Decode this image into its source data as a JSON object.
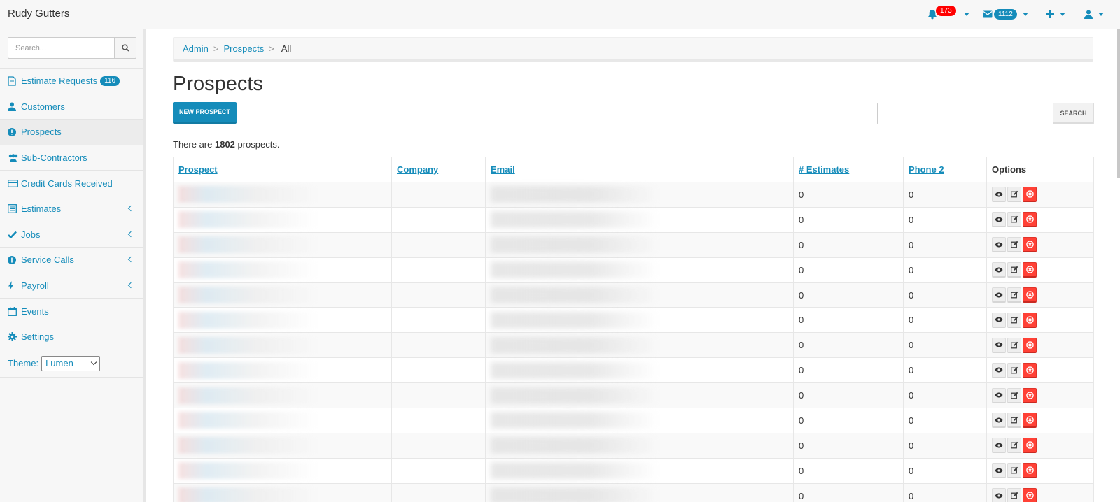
{
  "app": {
    "brand": "Rudy Gutters"
  },
  "topnav": {
    "notifications_count": "173",
    "messages_count": "1112"
  },
  "sidebar": {
    "search_placeholder": "Search...",
    "items": [
      {
        "label": "Estimate Requests",
        "badge": "116",
        "icon": "file-text-icon"
      },
      {
        "label": "Customers",
        "icon": "user-icon"
      },
      {
        "label": "Prospects",
        "icon": "exclamation-circle-icon",
        "active": true
      },
      {
        "label": "Sub-Contractors",
        "icon": "users-icon"
      },
      {
        "label": "Credit Cards Received",
        "icon": "credit-card-icon"
      },
      {
        "label": "Estimates",
        "icon": "list-alt-icon",
        "expandable": true
      },
      {
        "label": "Jobs",
        "icon": "check-icon",
        "expandable": true
      },
      {
        "label": "Service Calls",
        "icon": "exclamation-circle-icon",
        "expandable": true
      },
      {
        "label": "Payroll",
        "icon": "bolt-icon",
        "expandable": true
      },
      {
        "label": "Events",
        "icon": "calendar-icon"
      },
      {
        "label": "Settings",
        "icon": "gear-icon"
      }
    ],
    "theme_label": "Theme:",
    "theme_value": "Lumen"
  },
  "breadcrumb": {
    "admin": "Admin",
    "prospects": "Prospects",
    "current": "All",
    "sep": ">"
  },
  "page": {
    "title": "Prospects",
    "new_button": "NEW PROSPECT",
    "search_button": "SEARCH",
    "count_prefix": "There are ",
    "count_value": "1802",
    "count_suffix": " prospects."
  },
  "table": {
    "headers": {
      "prospect": "Prospect",
      "company": "Company",
      "email": "Email",
      "estimates": "# Estimates",
      "phone2": "Phone 2",
      "options": "Options"
    },
    "rows": [
      {
        "estimates": "0",
        "phone2": "0"
      },
      {
        "estimates": "0",
        "phone2": "0"
      },
      {
        "estimates": "0",
        "phone2": "0"
      },
      {
        "estimates": "0",
        "phone2": "0"
      },
      {
        "estimates": "0",
        "phone2": "0"
      },
      {
        "estimates": "0",
        "phone2": "0"
      },
      {
        "estimates": "0",
        "phone2": "0"
      },
      {
        "estimates": "0",
        "phone2": "0"
      },
      {
        "estimates": "0",
        "phone2": "0"
      },
      {
        "estimates": "0",
        "phone2": "0"
      },
      {
        "estimates": "0",
        "phone2": "0"
      },
      {
        "estimates": "0",
        "phone2": "0"
      },
      {
        "estimates": "0",
        "phone2": "0"
      }
    ]
  },
  "colors": {
    "accent": "#158cba",
    "danger": "#ff4136",
    "badge_red": "#ff0000"
  }
}
